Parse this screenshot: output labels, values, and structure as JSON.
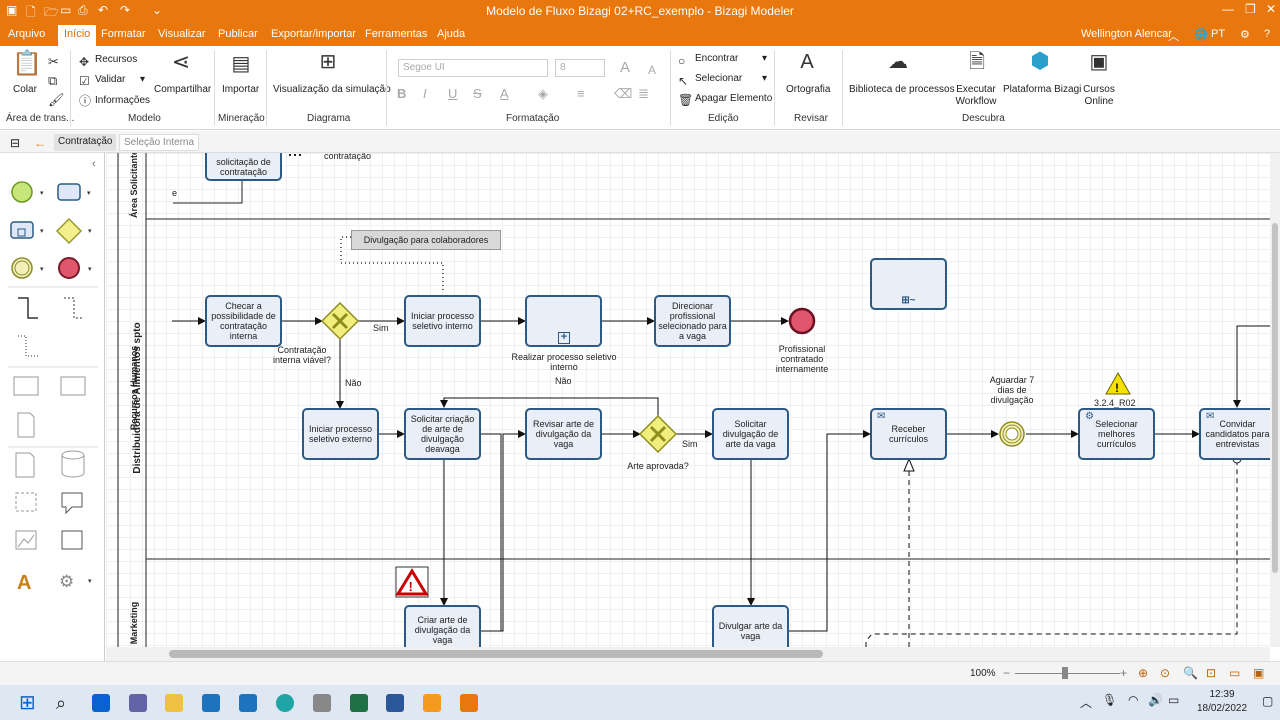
{
  "window": {
    "title": "Modelo de Fluxo Bizagi 02+RC_exemplo - Bizagi Modeler"
  },
  "menu": {
    "tabs": [
      "Arquivo",
      "Início",
      "Formatar",
      "Visualizar",
      "Publicar",
      "Exportar/importar",
      "Ferramentas",
      "Ajuda"
    ],
    "active": "Início",
    "user": "Wellington Alencar",
    "lang": "PT"
  },
  "ribbon": {
    "paste": "Colar",
    "clipboard_group": "Área de trans...",
    "recursos": "Recursos",
    "validar": "Validar",
    "informacoes": "Informações",
    "compartilhar": "Compartilhar",
    "modelo_group": "Modelo",
    "importar": "Importar",
    "mineracao_group": "Mineração",
    "simulacao": "Visualização da simulação",
    "diagrama_group": "Diagrama",
    "font_name": "Segoe UI",
    "font_size": "8",
    "formatacao_group": "Formatação",
    "encontrar": "Encontrar",
    "selecionar": "Selecionar",
    "apagar": "Apagar Elemento",
    "edicao_group": "Edição",
    "ortografia": "Ortografia",
    "revisar_group": "Revisar",
    "biblioteca": "Biblioteca de processos",
    "executar": "Executar Workflow",
    "plataforma": "Plataforma Bizagi",
    "cursos": "Cursos Online",
    "descubra_group": "Descubra"
  },
  "breadcrumb": {
    "tab1": "Contratação",
    "tab2": "Seleção Interna"
  },
  "diagram": {
    "pool": "Distribuidora de Alimentos spto",
    "lanes": {
      "solicitante": "Área Solicitante",
      "rh": "Recursos Humanos",
      "marketing": "Marketing"
    },
    "top_task": "solicitação de contratação",
    "top_label": "contratação",
    "top_e": "e",
    "annotation": "Divulgação para colaboradores",
    "tasks": {
      "checar": "Checar a possibilidade de contratação interna",
      "iniciar_interno": "Iniciar processo seletivo interno",
      "direcionar": "Direcionar profissional selecionado para a vaga",
      "iniciar_externo": "Iniciar processo seletivo externo",
      "solicitar_arte": "Solicitar criação de arte de divulgação deavaga",
      "revisar_arte": "Revisar arte de divulgação da vaga",
      "solicitar_div": "Solicitar divulgação de arte da vaga",
      "receber": "Receber currículos",
      "selecionar": "Selecionar melhores currículos",
      "convidar": "Convidar candidatos para entrevistas",
      "criar_arte": "Criar arte de divulgação da vaga",
      "divulgar": "Divulgar arte da vaga"
    },
    "labels": {
      "subprocesso": "Realizar processo seletivo interno",
      "end": "Profissional contratado internamente",
      "gw1": "Contratação interna viável?",
      "gw2": "Arte aprovada?",
      "sim1": "Sim",
      "nao1": "Não",
      "nao2": "Não",
      "sim2": "Sim",
      "timer": "Aguardar 7 dias de divulgação",
      "ref": "3.2.4_R02"
    }
  },
  "status": {
    "zoom": "100%"
  },
  "taskbar": {
    "time": "12:39",
    "date": "18/02/2022"
  }
}
